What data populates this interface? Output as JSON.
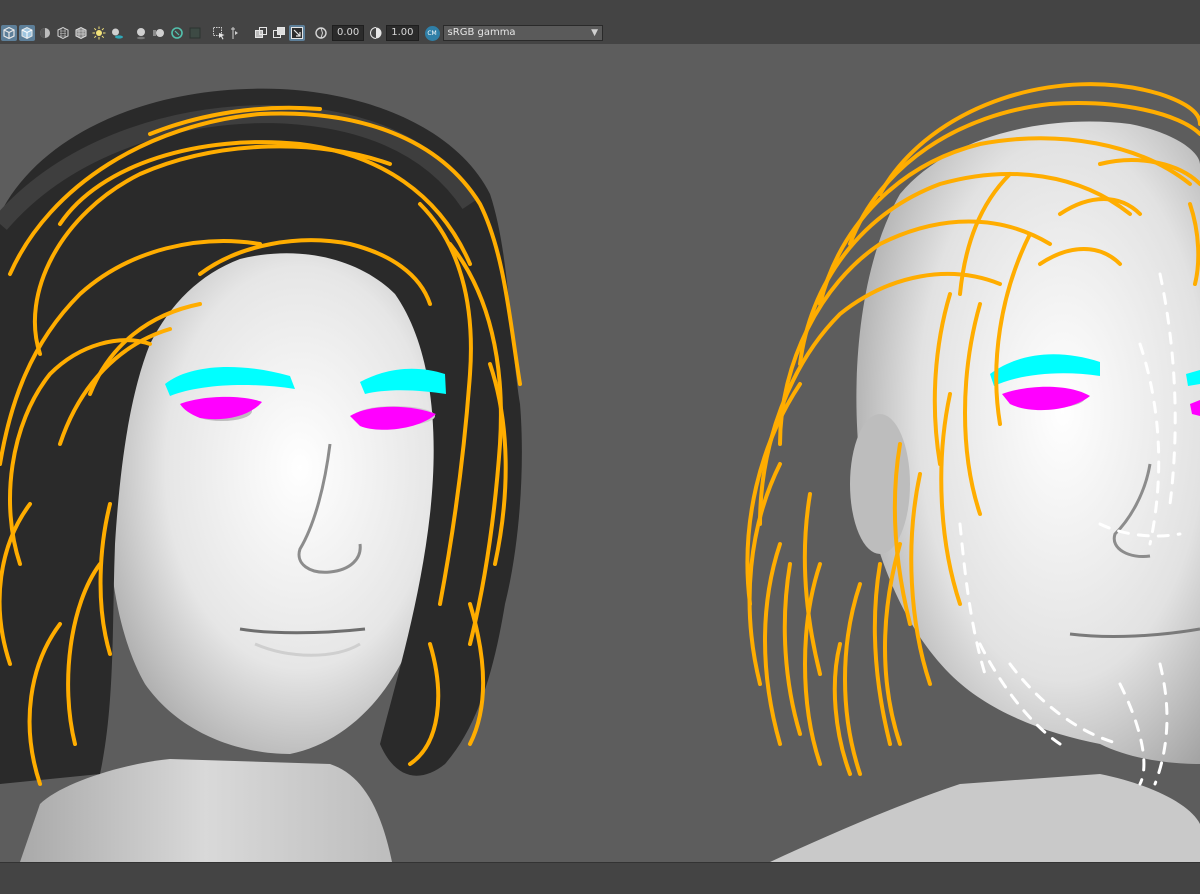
{
  "toolbar": {
    "exposure_value": "0.00",
    "gamma_value": "1.00",
    "color_management_badge": "CM",
    "color_space_label": "sRGB gamma",
    "icons": [
      "wireframe-cube-icon",
      "shaded-cube-icon",
      "smooth-shade-icon",
      "textured-cube-icon",
      "lights-icon",
      "shadows-icon",
      "ambient-occlusion-icon",
      "motion-blur-icon",
      "anti-alias-icon",
      "depth-of-field-icon",
      "isolate-select-icon",
      "xray-icon",
      "xray-joints-icon",
      "xray-components-icon",
      "exposure-icon",
      "gamma-icon"
    ],
    "accent_color": "#5d7f99"
  },
  "viewport": {
    "background_color": "#5d5d5d",
    "hair_guide_color": "#ffad00",
    "eyebrow_color": "#00ffff",
    "eyelash_color": "#ff00ff",
    "beard_guide_color": "#ffffff"
  }
}
